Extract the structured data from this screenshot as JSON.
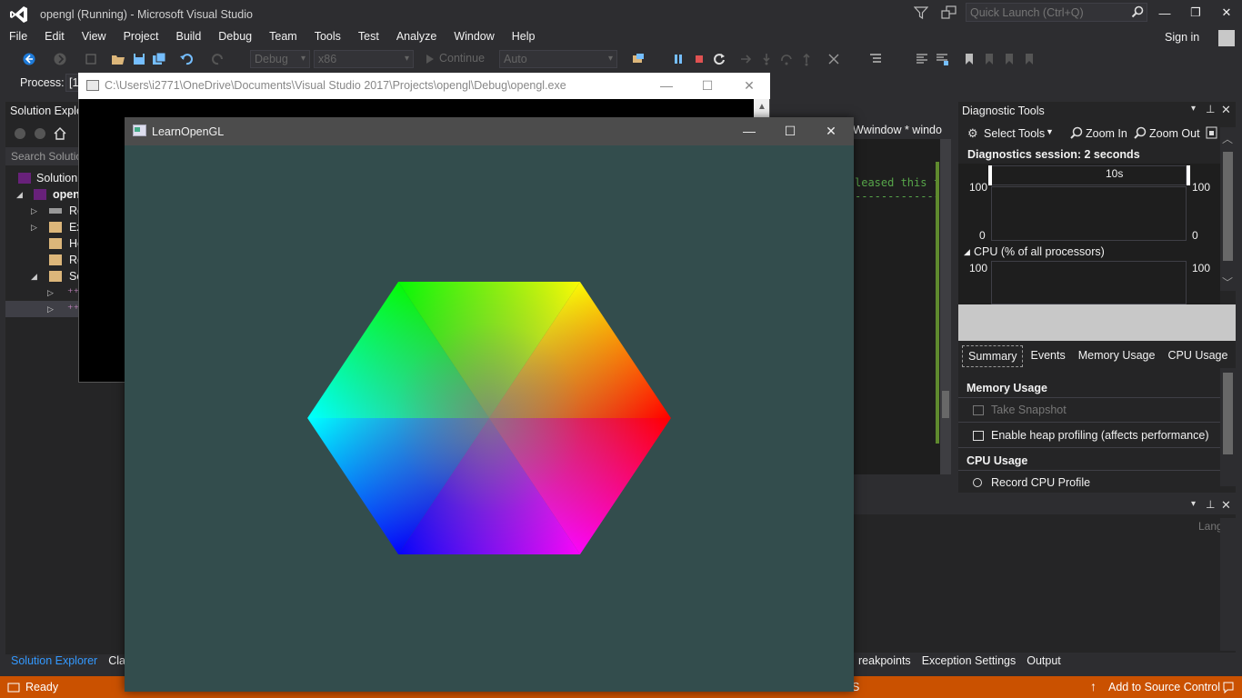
{
  "app": {
    "title": "opengl (Running) - Microsoft Visual Studio",
    "quick_launch_placeholder": "Quick Launch (Ctrl+Q)",
    "sign_in": "Sign in"
  },
  "menu": [
    "File",
    "Edit",
    "View",
    "Project",
    "Build",
    "Debug",
    "Team",
    "Tools",
    "Test",
    "Analyze",
    "Window",
    "Help"
  ],
  "toolbar": {
    "config": "Debug",
    "platform": "x86",
    "continue": "Continue",
    "auto": "Auto"
  },
  "process": {
    "label": "Process:",
    "value": "[1"
  },
  "solution_explorer": {
    "title": "Solution Explo",
    "search": "Search Solutio",
    "tree": [
      {
        "label": "Solution",
        "level": 0
      },
      {
        "label": "open",
        "level": 1
      },
      {
        "label": "Re",
        "level": 2
      },
      {
        "label": "Ex",
        "level": 2
      },
      {
        "label": "He",
        "level": 2
      },
      {
        "label": "Re",
        "level": 2
      },
      {
        "label": "So",
        "level": 2
      },
      {
        "label": "",
        "level": 3
      },
      {
        "label": "",
        "level": 3
      }
    ]
  },
  "console": {
    "title": "C:\\Users\\i2771\\OneDrive\\Documents\\Visual Studio 2017\\Projects\\opengl\\Debug\\opengl.exe"
  },
  "editor": {
    "tab": "Wwindow * windo",
    "line1": "leased this f",
    "line2": "-------------"
  },
  "diagnostic": {
    "title": "Diagnostic Tools",
    "select_tools": "Select Tools",
    "zoom_in": "Zoom In",
    "zoom_out": "Zoom Out",
    "session": "Diagnostics session: 2 seconds",
    "timeline_label": "10s",
    "memory_top_left": "100",
    "memory_top_right": "100",
    "memory_bottom_left": "0",
    "memory_bottom_right": "0",
    "cpu_title": "CPU (% of all processors)",
    "cpu_left": "100",
    "cpu_right": "100",
    "tabs": [
      "Summary",
      "Events",
      "Memory Usage",
      "CPU Usage"
    ],
    "active_tab": "Summary",
    "memory_section": "Memory Usage",
    "take_snapshot": "Take Snapshot",
    "heap_profiling": "Enable heap profiling (affects performance)",
    "cpu_section": "CPU Usage",
    "record_cpu": "Record CPU Profile"
  },
  "output_panel": {
    "lang": "Lang"
  },
  "bottom_tabs_left": [
    "Solution Explorer",
    "Class"
  ],
  "bottom_tabs_right": [
    "reakpoints",
    "Exception Settings",
    "Output"
  ],
  "status": {
    "ready": "Ready",
    "middle": "S",
    "source_control": "Add to Source Control"
  },
  "gl_window": {
    "title": "LearnOpenGL",
    "clear_color": "#334d4d"
  }
}
